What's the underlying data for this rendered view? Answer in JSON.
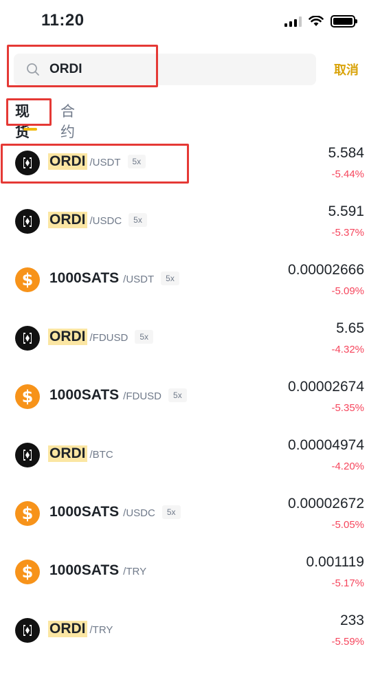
{
  "status_bar": {
    "time": "11:20"
  },
  "search": {
    "value": "ORDI",
    "cancel_label": "取消"
  },
  "tabs": [
    {
      "label": "现货",
      "active": true
    },
    {
      "label": "合约",
      "active": false
    }
  ],
  "colors": {
    "accent": "#f0b90b",
    "negative": "#f6465d",
    "highlight_box": "#e53935"
  },
  "markets": [
    {
      "icon": "ordi-icon",
      "base": "ORDI",
      "quote": "/USDT",
      "leverage": "5x",
      "price": "5.584",
      "change": "-5.44%",
      "highlighted": true
    },
    {
      "icon": "ordi-icon",
      "base": "ORDI",
      "quote": "/USDC",
      "leverage": "5x",
      "price": "5.591",
      "change": "-5.37%",
      "highlighted": true
    },
    {
      "icon": "sats-icon",
      "base": "1000SATS",
      "quote": "/USDT",
      "leverage": "5x",
      "price": "0.00002666",
      "change": "-5.09%",
      "highlighted": false
    },
    {
      "icon": "ordi-icon",
      "base": "ORDI",
      "quote": "/FDUSD",
      "leverage": "5x",
      "price": "5.65",
      "change": "-4.32%",
      "highlighted": true
    },
    {
      "icon": "sats-icon",
      "base": "1000SATS",
      "quote": "/FDUSD",
      "leverage": "5x",
      "price": "0.00002674",
      "change": "-5.35%",
      "highlighted": false
    },
    {
      "icon": "ordi-icon",
      "base": "ORDI",
      "quote": "/BTC",
      "leverage": "",
      "price": "0.00004974",
      "change": "-4.20%",
      "highlighted": true
    },
    {
      "icon": "sats-icon",
      "base": "1000SATS",
      "quote": "/USDC",
      "leverage": "5x",
      "price": "0.00002672",
      "change": "-5.05%",
      "highlighted": false
    },
    {
      "icon": "sats-icon",
      "base": "1000SATS",
      "quote": "/TRY",
      "leverage": "",
      "price": "0.001119",
      "change": "-5.17%",
      "highlighted": false
    },
    {
      "icon": "ordi-icon",
      "base": "ORDI",
      "quote": "/TRY",
      "leverage": "",
      "price": "233",
      "change": "-5.59%",
      "highlighted": true
    }
  ]
}
